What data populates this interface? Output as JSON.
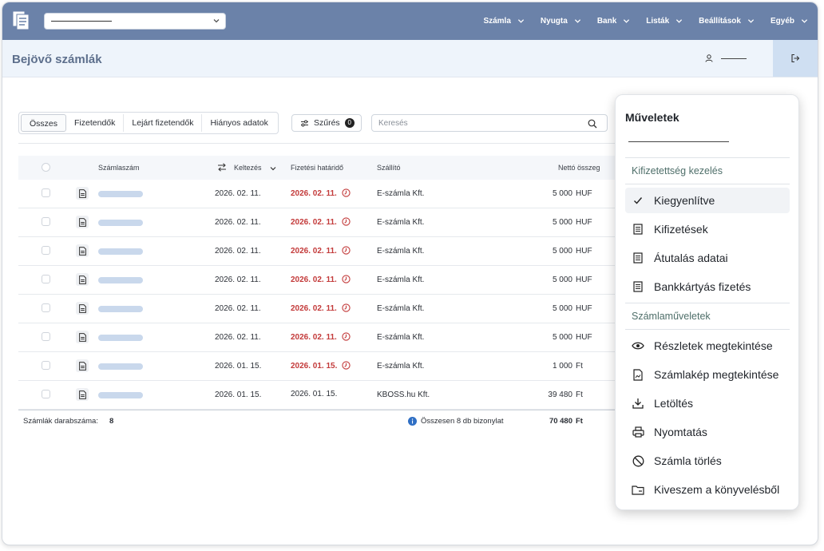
{
  "nav": {
    "items": [
      {
        "label": "Számla"
      },
      {
        "label": "Nyugta"
      },
      {
        "label": "Bank"
      },
      {
        "label": "Listák"
      },
      {
        "label": "Beállítások"
      },
      {
        "label": "Egyéb"
      }
    ]
  },
  "header": {
    "title": "Bejövő számlák"
  },
  "filters": {
    "tabs": [
      "Összes",
      "Fizetendők",
      "Lejárt fizetendők",
      "Hiányos adatok"
    ],
    "filter_label": "Szűrés",
    "filter_count": "0",
    "search_placeholder": "Keresés"
  },
  "table": {
    "headers": {
      "number": "Számlaszám",
      "date": "Keltezés",
      "due": "Fizetési határidő",
      "supplier": "Szállító",
      "net": "Nettó összeg"
    },
    "rows": [
      {
        "date": "2026. 02. 11.",
        "due": "2026. 02. 11.",
        "late": true,
        "supplier": "E-számla Kft.",
        "amount": "5 000",
        "currency": "HUF"
      },
      {
        "date": "2026. 02. 11.",
        "due": "2026. 02. 11.",
        "late": true,
        "supplier": "E-számla Kft.",
        "amount": "5 000",
        "currency": "HUF"
      },
      {
        "date": "2026. 02. 11.",
        "due": "2026. 02. 11.",
        "late": true,
        "supplier": "E-számla Kft.",
        "amount": "5 000",
        "currency": "HUF"
      },
      {
        "date": "2026. 02. 11.",
        "due": "2026. 02. 11.",
        "late": true,
        "supplier": "E-számla Kft.",
        "amount": "5 000",
        "currency": "HUF"
      },
      {
        "date": "2026. 02. 11.",
        "due": "2026. 02. 11.",
        "late": true,
        "supplier": "E-számla Kft.",
        "amount": "5 000",
        "currency": "HUF"
      },
      {
        "date": "2026. 02. 11.",
        "due": "2026. 02. 11.",
        "late": true,
        "supplier": "E-számla Kft.",
        "amount": "5 000",
        "currency": "HUF"
      },
      {
        "date": "2026. 01. 15.",
        "due": "2026. 01. 15.",
        "late": true,
        "supplier": "E-számla Kft.",
        "amount": "1 000",
        "currency": "Ft"
      },
      {
        "date": "2026. 01. 15.",
        "due": "2026. 01. 15.",
        "late": false,
        "supplier": "KBOSS.hu Kft.",
        "amount": "39 480",
        "currency": "Ft"
      }
    ]
  },
  "footer": {
    "count_label": "Számlák darabszáma:",
    "count_value": "8",
    "total_label": "Összesen 8 db bizonylat",
    "total_amount": "70 480",
    "total_currency": "Ft"
  },
  "actions": {
    "title": "Műveletek",
    "section1": "Kifizetettség kezelés",
    "items1": [
      "Kiegyenlítve",
      "Kifizetések",
      "Átutalás adatai",
      "Bankkártyás fizetés"
    ],
    "section2": "Számlaműveletek",
    "items2": [
      "Részletek megtekintése",
      "Számlakép megtekintése",
      "Letöltés",
      "Nyomtatás",
      "Számla törlés",
      "Kiveszem a könyvelésből"
    ]
  },
  "colors": {
    "topbar": "#6b82a9",
    "late": "#c33a3a",
    "accent": "#cfdff2"
  }
}
